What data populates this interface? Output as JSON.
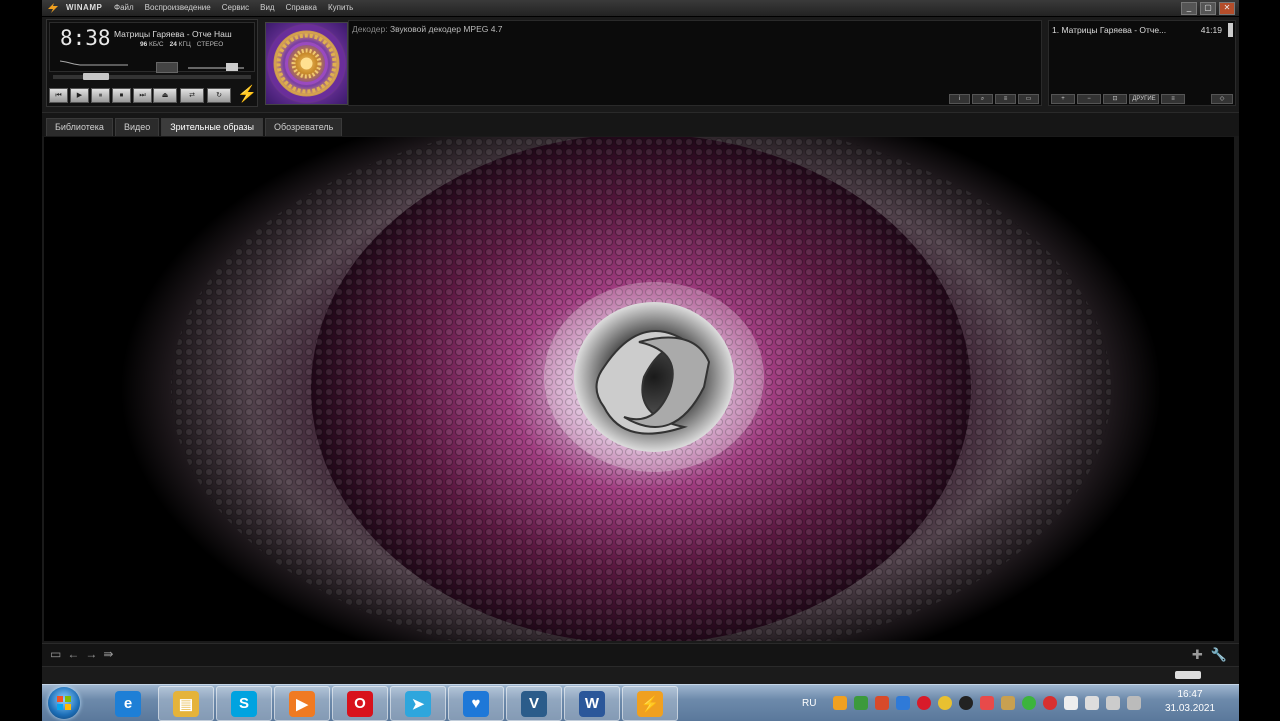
{
  "titlebar": {
    "app_name": "WINAMP",
    "menu": [
      "Файл",
      "Воспроизведение",
      "Сервис",
      "Вид",
      "Справка",
      "Купить"
    ],
    "window_buttons": [
      "_",
      "▢",
      "✕"
    ]
  },
  "player": {
    "time": "8:38",
    "track_title": "Матрицы Гаряева - Отче Наш",
    "bitrate": "96",
    "bitrate_unit": "КБ/С",
    "khz": "24",
    "khz_unit": "КГЦ",
    "stereo": "СТЕРЕО",
    "controls": [
      "⏮",
      "▶",
      "⏸",
      "⏹",
      "⏭"
    ],
    "eject": "⏏",
    "shuffle": "⇄",
    "repeat": "↻"
  },
  "info": {
    "decoder_label": "Декодер:",
    "decoder_value": "Звуковой декодер MPEG 4.7"
  },
  "playlist": {
    "items": [
      {
        "title": "1. Матрицы Гаряева - Отче...",
        "duration": "41:19"
      }
    ],
    "buttons": [
      "+",
      "−",
      "⊡",
      "ДРУГИЕ",
      "≡"
    ]
  },
  "tabs": [
    "Библиотека",
    "Видео",
    "Зрительные образы",
    "Обозреватель"
  ],
  "active_tab": "Зрительные образы",
  "taskbar": {
    "language": "RU",
    "time": "16:47",
    "date": "31.03.2021",
    "apps": [
      {
        "name": "ie",
        "glyph": "e",
        "color": "#1e7fd6"
      },
      {
        "name": "explorer",
        "glyph": "▤",
        "color": "#e5b33a"
      },
      {
        "name": "skype",
        "glyph": "S",
        "color": "#00a3e0"
      },
      {
        "name": "media-player",
        "glyph": "▶",
        "color": "#f07a22"
      },
      {
        "name": "opera",
        "glyph": "O",
        "color": "#d8121c"
      },
      {
        "name": "telegram",
        "glyph": "➤",
        "color": "#2ea6dd"
      },
      {
        "name": "heart-app",
        "glyph": "♥",
        "color": "#1e78d8"
      },
      {
        "name": "vk-app",
        "glyph": "V",
        "color": "#2b5c8a"
      },
      {
        "name": "word",
        "glyph": "W",
        "color": "#2b579a"
      },
      {
        "name": "winamp",
        "glyph": "⚡",
        "color": "#f0a020"
      }
    ]
  }
}
